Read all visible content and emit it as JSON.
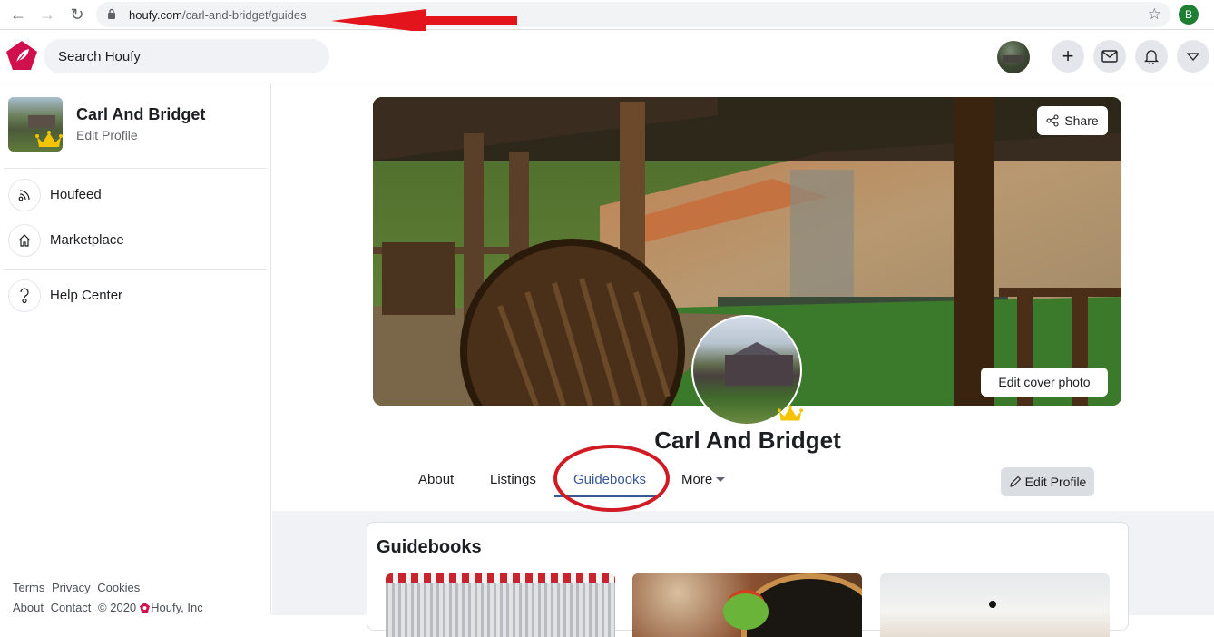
{
  "browser": {
    "url_host": "houfy.com",
    "url_path": "/carl-and-bridget/guides",
    "profile_initial": "B",
    "profile_color": "#1e7e34"
  },
  "header": {
    "search_placeholder": "Search Houfy",
    "brand_color": "#d0104c",
    "buttons": [
      "add",
      "messages",
      "notifications",
      "menu"
    ]
  },
  "sidebar": {
    "profile_name": "Carl And Bridget",
    "profile_sub": "Edit Profile",
    "items": [
      {
        "label": "Houfeed",
        "icon": "rss-icon"
      },
      {
        "label": "Marketplace",
        "icon": "home-icon"
      },
      {
        "label": "Help Center",
        "icon": "help-icon"
      }
    ],
    "footer": {
      "links_row1": [
        "Terms",
        "Privacy",
        "Cookies"
      ],
      "links_row2": [
        "About",
        "Contact"
      ],
      "copyright": "© 2020",
      "company": "Houfy, Inc"
    }
  },
  "profile": {
    "name": "Carl And Bridget",
    "share_label": "Share",
    "edit_cover_label": "Edit cover photo",
    "edit_profile_label": "Edit Profile",
    "tabs": [
      {
        "label": "About",
        "active": false
      },
      {
        "label": "Listings",
        "active": false
      },
      {
        "label": "Guidebooks",
        "active": true
      },
      {
        "label": "More",
        "active": false
      }
    ],
    "accent_color": "#385898"
  },
  "guidebooks": {
    "title": "Guidebooks",
    "items": [
      {
        "image": "shopping-carts"
      },
      {
        "image": "tree-frog"
      },
      {
        "image": "light-photo"
      }
    ]
  },
  "annotations": {
    "arrow_color": "#e3141b",
    "circle_color": "#d01a24"
  }
}
